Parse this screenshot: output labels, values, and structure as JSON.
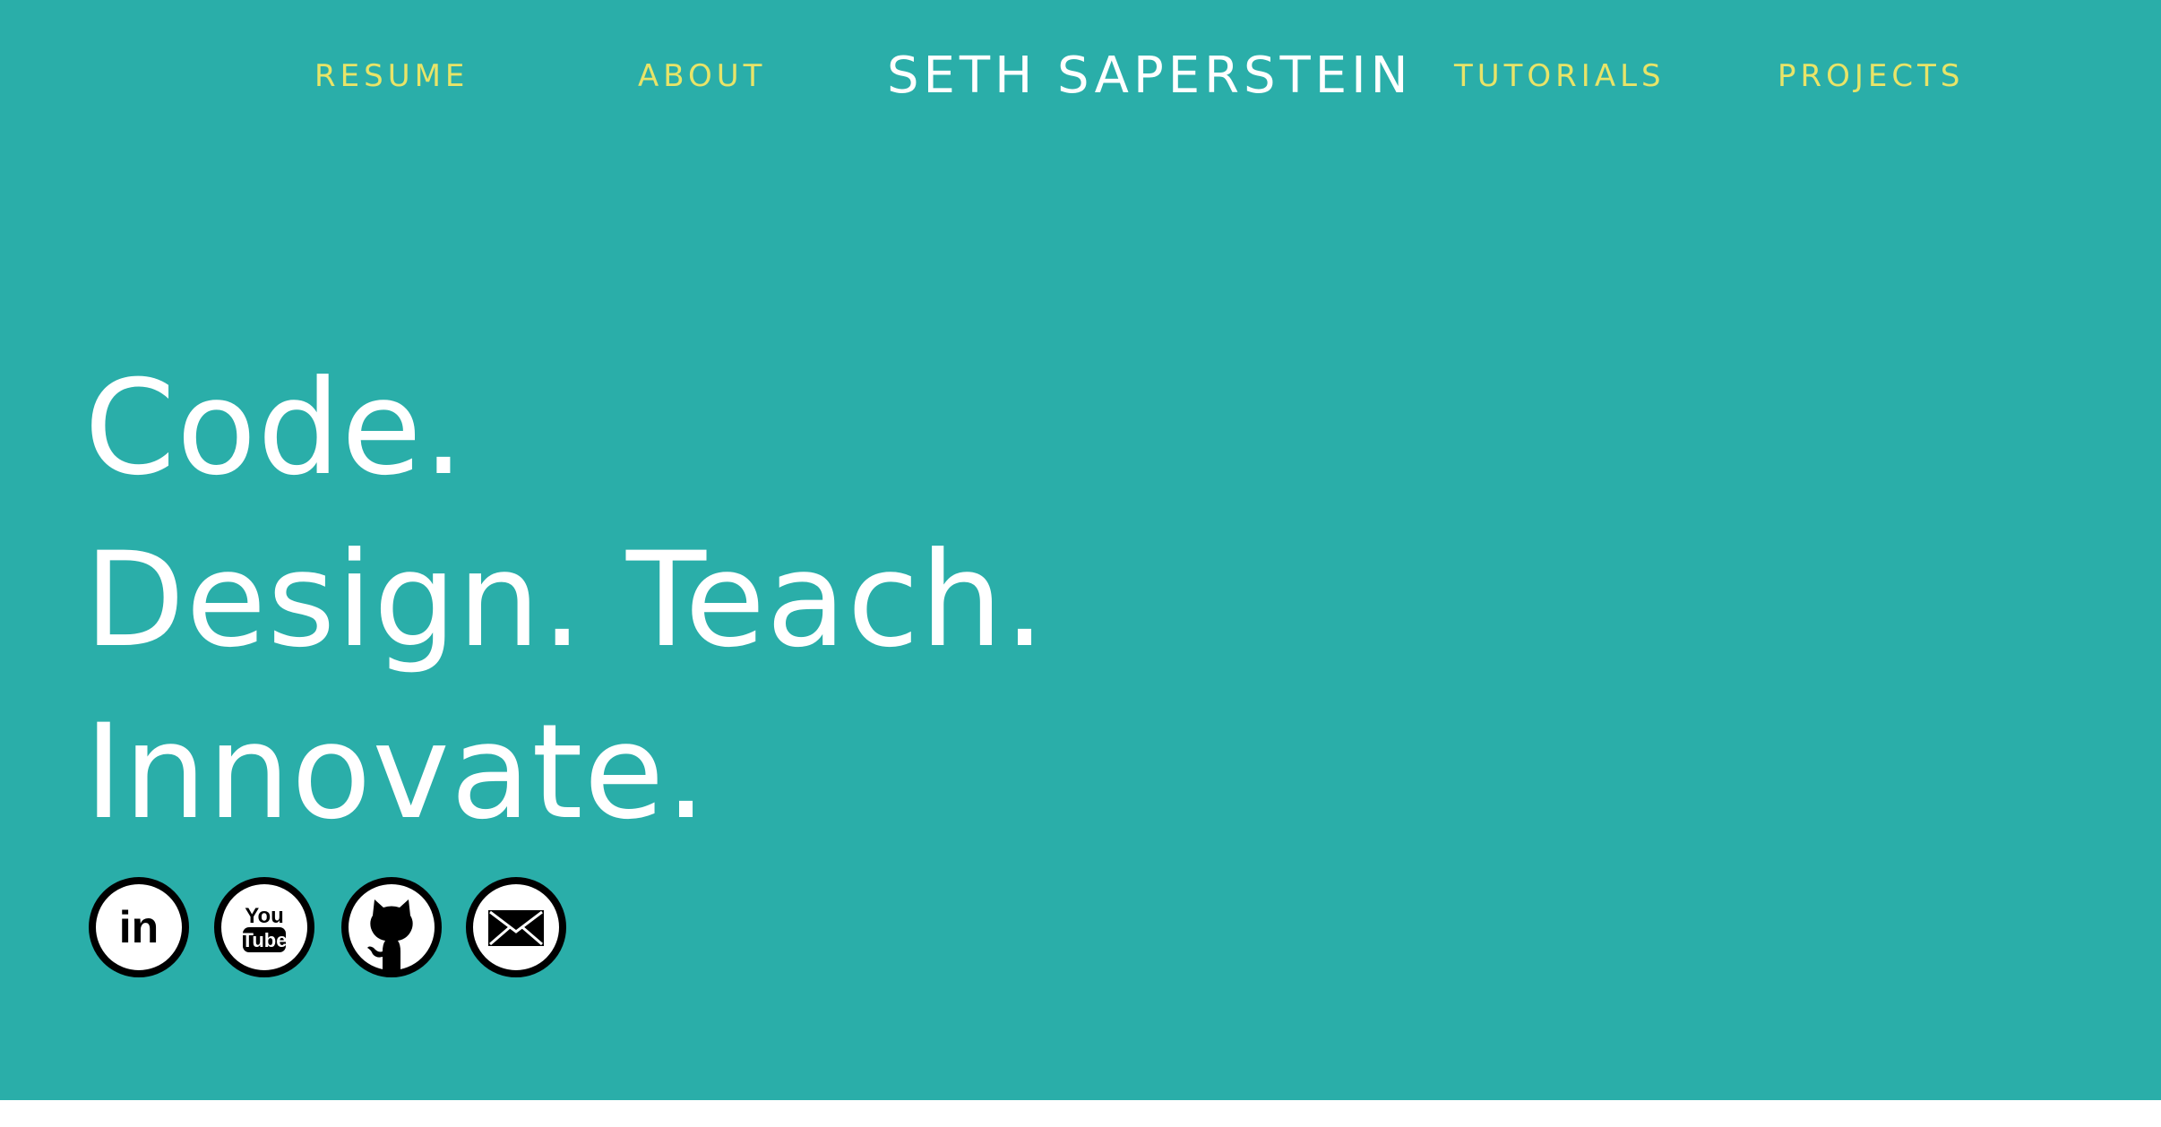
{
  "nav": {
    "resume": "RESUME",
    "about": "ABOUT",
    "tutorials": "TUTORIALS",
    "projects": "PROJECTS"
  },
  "site_title": "SETH SAPERSTEIN",
  "headline": {
    "line1": "Code.",
    "line2": "Design. Teach.",
    "line3": "Innovate."
  },
  "social": {
    "linkedin": "in",
    "youtube_top": "You",
    "youtube_bottom": "Tube"
  },
  "icons": {
    "linkedin": "linkedin-icon",
    "youtube": "youtube-icon",
    "github": "github-icon",
    "email": "email-icon"
  },
  "colors": {
    "background": "#2aaea9",
    "nav_link": "#e8e468",
    "title": "#ffffff",
    "footer_strip": "#ffffff"
  }
}
